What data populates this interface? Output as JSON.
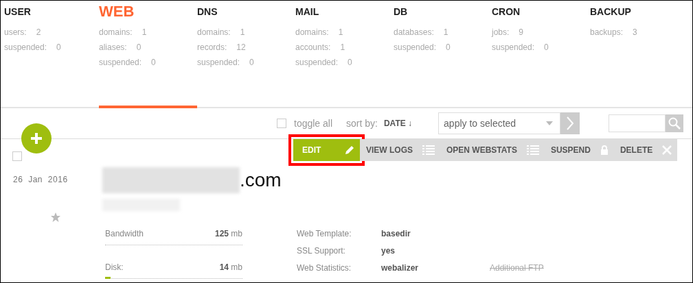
{
  "tabs": [
    {
      "title": "USER",
      "selected": false,
      "stats": [
        {
          "label": "users:",
          "value": "2"
        },
        {
          "label": "suspended:",
          "value": "0"
        }
      ]
    },
    {
      "title": "WEB",
      "selected": true,
      "stats": [
        {
          "label": "domains:",
          "value": "1"
        },
        {
          "label": "aliases:",
          "value": "0"
        },
        {
          "label": "suspended:",
          "value": "0"
        }
      ]
    },
    {
      "title": "DNS",
      "selected": false,
      "stats": [
        {
          "label": "domains:",
          "value": "1"
        },
        {
          "label": "records:",
          "value": "12"
        },
        {
          "label": "suspended:",
          "value": "0"
        }
      ]
    },
    {
      "title": "MAIL",
      "selected": false,
      "stats": [
        {
          "label": "domains:",
          "value": "1"
        },
        {
          "label": "accounts:",
          "value": "1"
        },
        {
          "label": "suspended:",
          "value": "0"
        }
      ]
    },
    {
      "title": "DB",
      "selected": false,
      "stats": [
        {
          "label": "databases:",
          "value": "1"
        },
        {
          "label": "suspended:",
          "value": "0"
        }
      ]
    },
    {
      "title": "CRON",
      "selected": false,
      "stats": [
        {
          "label": "jobs:",
          "value": "9"
        },
        {
          "label": "suspended:",
          "value": "0"
        }
      ]
    },
    {
      "title": "BACKUP",
      "selected": false,
      "stats": [
        {
          "label": "backups:",
          "value": "3"
        }
      ]
    }
  ],
  "toolbar": {
    "toggle_all": {
      "label": "toggle all",
      "checked": false
    },
    "sort_label": "sort by:",
    "sort_value": "DATE ↓",
    "bulk_action": {
      "value": "apply to selected"
    }
  },
  "domain": {
    "checked": false,
    "date": "26 Jan 2016",
    "name_suffix": ".com",
    "starred": false,
    "actions": [
      {
        "label": "EDIT",
        "kind": "edit",
        "highlighted": true
      },
      {
        "label": "VIEW LOGS",
        "kind": "list",
        "highlighted": false
      },
      {
        "label": "OPEN WEBSTATS",
        "kind": "list",
        "highlighted": false
      },
      {
        "label": "SUSPEND",
        "kind": "lock",
        "highlighted": false
      },
      {
        "label": "DELETE",
        "kind": "close",
        "highlighted": false
      }
    ],
    "usage": [
      {
        "label": "Bandwidth",
        "amount": "125",
        "unit": "mb"
      },
      {
        "label": "Disk:",
        "amount": "14",
        "unit": "mb",
        "level": 0.04
      }
    ],
    "details": [
      {
        "label": "Web Template:",
        "value": "basedir"
      },
      {
        "label": "SSL Support:",
        "value": "yes"
      },
      {
        "label": "Web Statistics:",
        "value": "webalizer"
      }
    ],
    "extra": {
      "label": "Additional FTP",
      "disabled": true
    }
  }
}
